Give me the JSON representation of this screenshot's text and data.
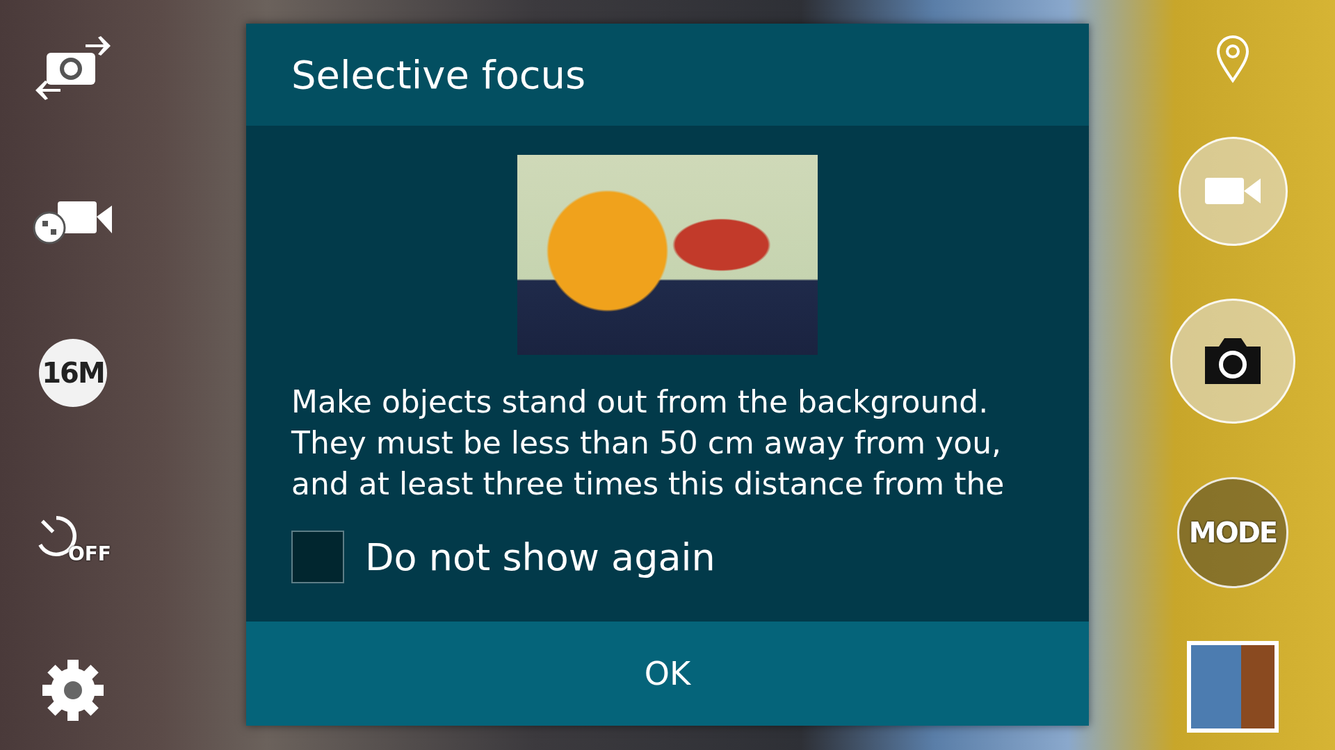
{
  "left_controls": [
    {
      "kind": "switch-camera"
    },
    {
      "kind": "effects"
    },
    {
      "kind": "resolution",
      "label": "16M"
    },
    {
      "kind": "timer",
      "label": "OFF"
    },
    {
      "kind": "settings"
    }
  ],
  "dialog": {
    "title": "Selective focus",
    "description": [
      "Make objects stand out from the background.",
      "They must be less than 50 cm away from you,",
      "and at least three times this distance from the"
    ],
    "checkbox": {
      "label": "Do not show again",
      "checked": false
    },
    "button": "OK"
  },
  "right_controls": [
    {
      "kind": "location"
    },
    {
      "kind": "record"
    },
    {
      "kind": "shutter"
    },
    {
      "kind": "mode",
      "label": "MODE"
    },
    {
      "kind": "gallery"
    }
  ]
}
